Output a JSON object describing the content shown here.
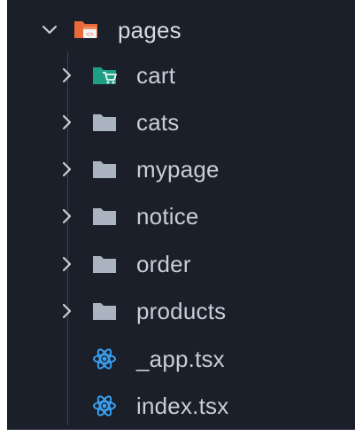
{
  "explorer": {
    "root": {
      "label": "pages",
      "icon": "folder-pages-icon",
      "expanded": true
    },
    "children": [
      {
        "label": "cart",
        "type": "folder",
        "icon": "folder-cart-icon"
      },
      {
        "label": "cats",
        "type": "folder",
        "icon": "folder-icon"
      },
      {
        "label": "mypage",
        "type": "folder",
        "icon": "folder-icon"
      },
      {
        "label": "notice",
        "type": "folder",
        "icon": "folder-icon"
      },
      {
        "label": "order",
        "type": "folder",
        "icon": "folder-icon"
      },
      {
        "label": "products",
        "type": "folder",
        "icon": "folder-icon"
      },
      {
        "label": "_app.tsx",
        "type": "file",
        "icon": "react-icon"
      },
      {
        "label": "index.tsx",
        "type": "file",
        "icon": "react-icon"
      }
    ]
  },
  "colors": {
    "background": "#1b1f2a",
    "text": "#c8cdd8",
    "folder_gray": "#aab3c0",
    "folder_cart_teal": "#1f9e86",
    "folder_pages_orange": "#e86a3a",
    "react_blue": "#3aa0f0"
  }
}
